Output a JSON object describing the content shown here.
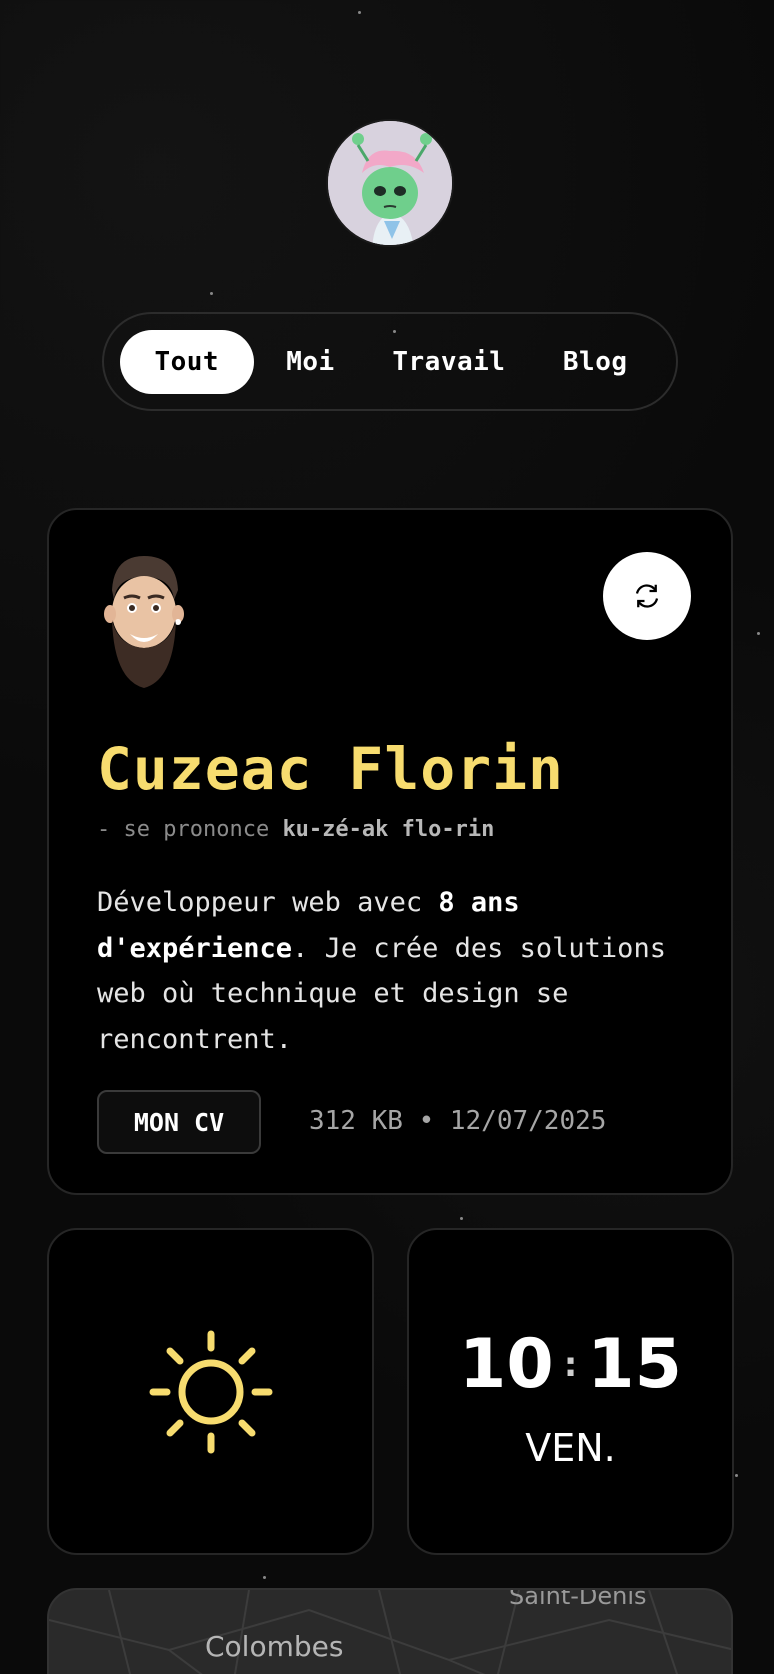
{
  "nav": {
    "items": [
      {
        "label": "Tout",
        "active": true
      },
      {
        "label": "Moi",
        "active": false
      },
      {
        "label": "Travail",
        "active": false
      },
      {
        "label": "Blog",
        "active": false
      }
    ]
  },
  "intro": {
    "name": "Cuzeac Florin",
    "pronounce_prefix": "- se prononce ",
    "pronounce": "ku-zé-ak flo-rin",
    "desc_1": "Développeur web avec ",
    "desc_bold": "8 ans d'expérience",
    "desc_2": ". Je crée des solutions web où technique et design se rencontrent.",
    "cv_label": "MON CV",
    "cv_meta": "312 KB • 12/07/2025"
  },
  "widgets": {
    "hour": "10",
    "separator": ":",
    "minute": "15",
    "day": "VEN."
  },
  "map": {
    "label_1": "Colombes",
    "label_2": "Saint-Denis"
  },
  "colors": {
    "accent_yellow": "#f7dc6f",
    "background": "#0a0a0a",
    "card": "#000000"
  },
  "icons": [
    "refresh-icon",
    "sun-icon"
  ]
}
